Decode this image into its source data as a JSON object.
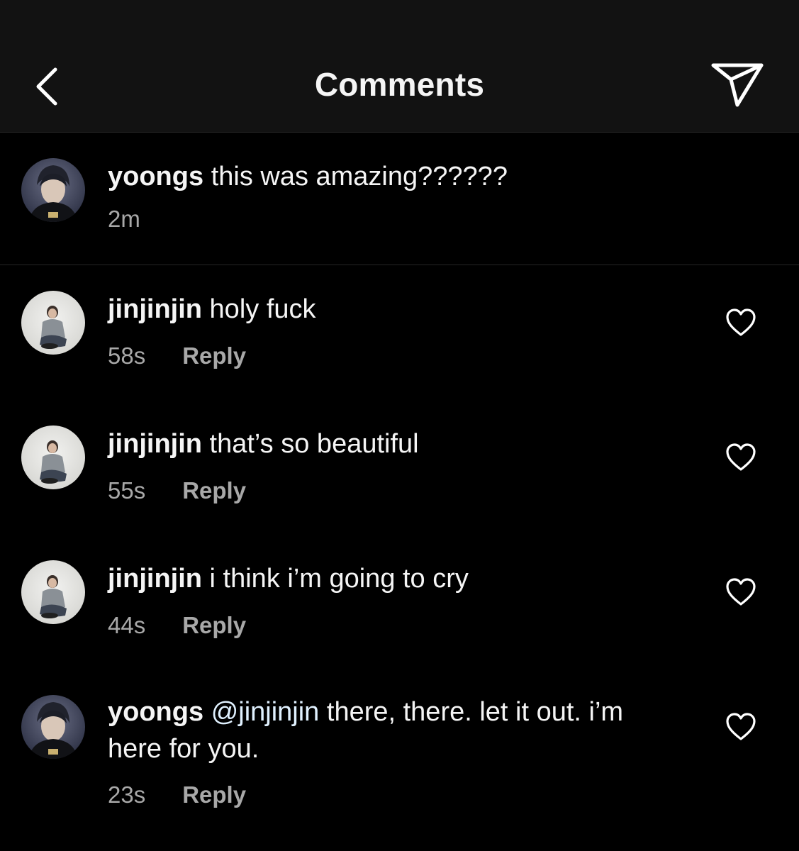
{
  "header": {
    "title": "Comments"
  },
  "caption": {
    "username": "yoongs",
    "text": "this was amazing??????",
    "time": "2m"
  },
  "comments": [
    {
      "username": "jinjinjin",
      "mention": "",
      "text": "holy fuck",
      "time": "58s",
      "reply_label": "Reply"
    },
    {
      "username": "jinjinjin",
      "mention": "",
      "text": "that’s so beautiful",
      "time": "55s",
      "reply_label": "Reply"
    },
    {
      "username": "jinjinjin",
      "mention": "",
      "text": "i think i’m going to cry",
      "time": "44s",
      "reply_label": "Reply"
    },
    {
      "username": "yoongs",
      "mention": "@jinjinjin",
      "text": "there, there. let it out. i’m here for you.",
      "time": "23s",
      "reply_label": "Reply"
    }
  ],
  "icons": {
    "back": "chevron-left-icon",
    "share": "paper-plane-icon",
    "like": "heart-outline-icon"
  },
  "colors": {
    "background": "#000000",
    "header_background": "#121212",
    "secondary_text": "#a8a8a8",
    "mention": "#e0f1ff"
  }
}
